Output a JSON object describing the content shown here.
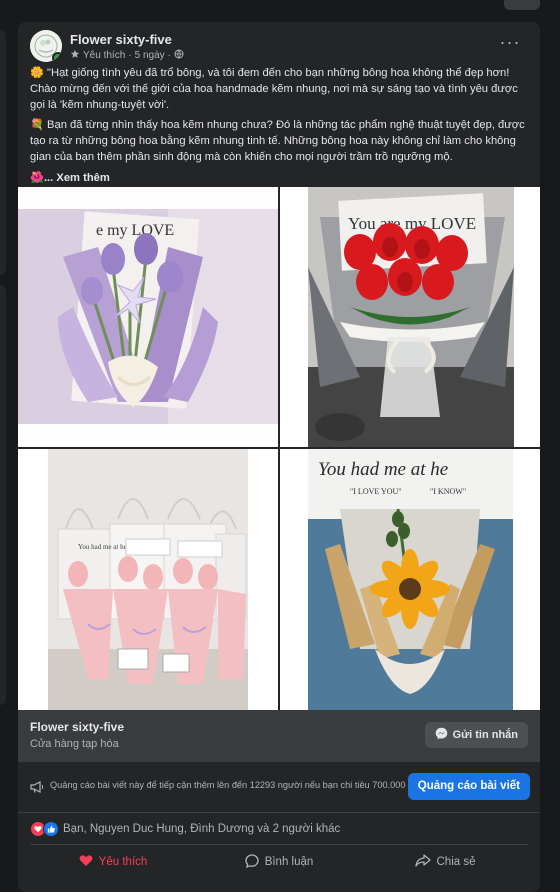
{
  "post": {
    "page_name": "Flower sixty-five",
    "meta_liked": "Yêu thích",
    "meta_sep": "·",
    "meta_time": "5 ngày",
    "meta_sep2": "·",
    "more_label": "···",
    "paragraph_1": "🌼 \"Hạt giống tình yêu đã trổ bông, và tôi đem đến cho bạn những bông hoa không thể đẹp hơn! Chào mừng đến với thế giới của hoa handmade kẽm nhung, nơi mà sự sáng tạo và tình yêu được gọi là 'kẽm nhung-tuyệt vời'.",
    "paragraph_2": "💐 Bạn đã từng nhìn thấy hoa kẽm nhung chưa? Đó là những tác phẩm nghệ thuật tuyệt đẹp, được tạo ra từ những bông hoa bằng kẽm nhung tinh tế. Những bông hoa này không chỉ làm cho không gian của bạn thêm phần sinh động mà còn khiến cho mọi người trầm trồ ngưỡng mộ.",
    "see_more_emoji": "🌺",
    "see_more": "... Xem thêm"
  },
  "photos": {
    "p1_text": "e my LOVE",
    "p2_text": "You are my LOVE",
    "p3_tag": "You had me at hello",
    "p4_text": "You had me at he",
    "p4_sub1": "\"I LOVE YOU\"",
    "p4_sub2": "\"I KNOW\""
  },
  "ad": {
    "name": "Flower sixty-five",
    "category": "Cửa hàng tạp hóa",
    "message_button": "Gửi tin nhắn"
  },
  "boost": {
    "text": "Quảng cáo bài viết này để tiếp cận thêm lên đến 12293 người nếu bạn chi tiêu 700.000 ₫.",
    "button": "Quảng cáo bài viết"
  },
  "reactions": {
    "summary": "Bạn, Nguyen Duc Hung, Đình Dương và 2 người khác"
  },
  "actions": {
    "like": "Yêu thích",
    "comment": "Bình luận",
    "share": "Chia sẻ"
  },
  "colors": {
    "accent": "#1b74e4",
    "love": "#f33e58",
    "background": "#18191a",
    "card": "#242526"
  }
}
